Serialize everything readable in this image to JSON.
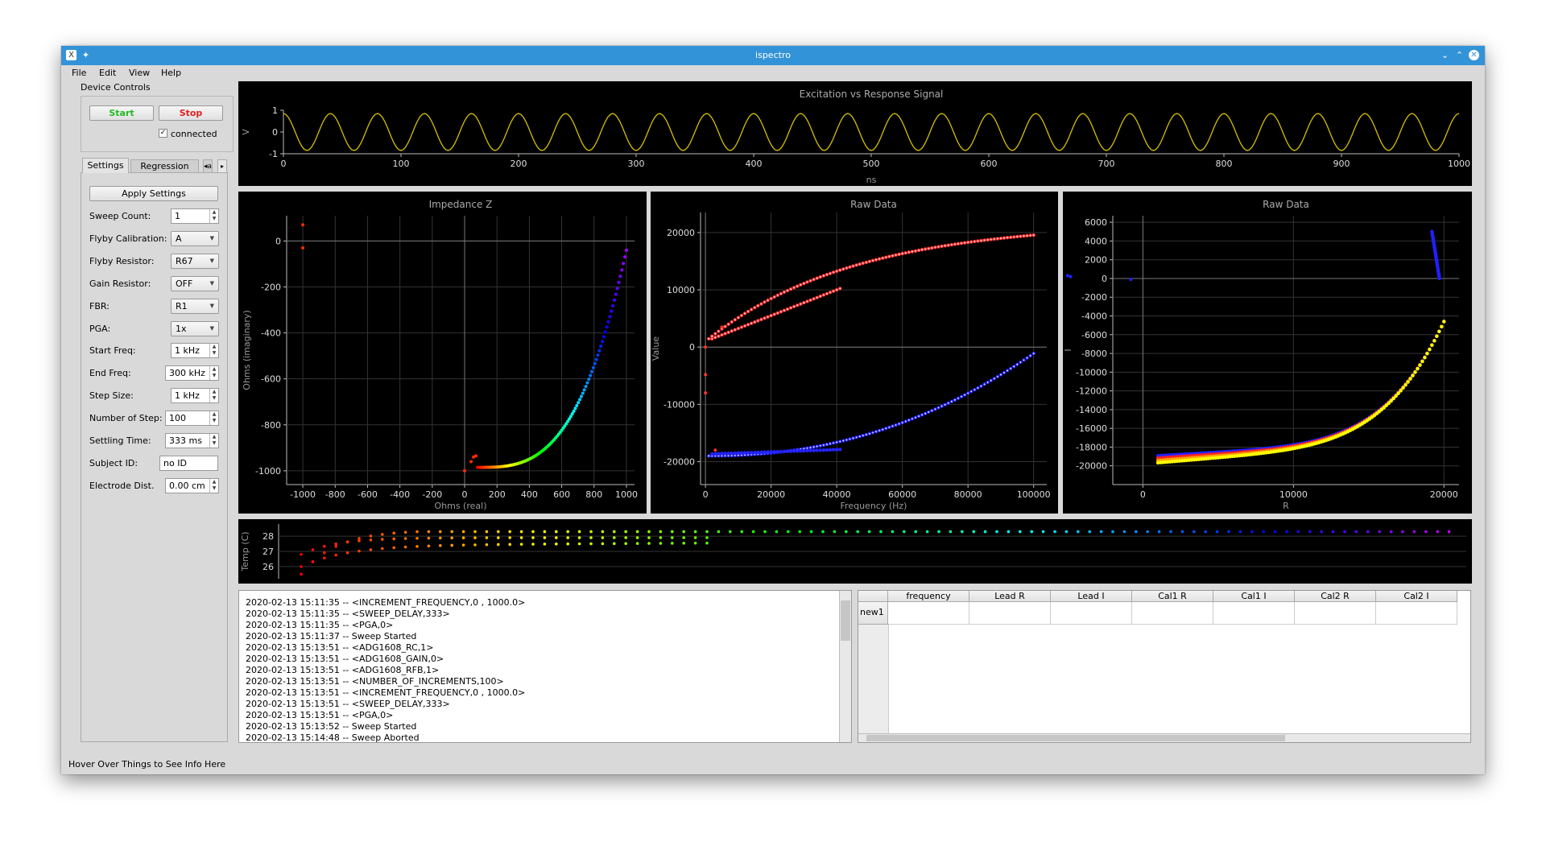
{
  "window": {
    "title": "ispectro"
  },
  "menu": [
    "File",
    "Edit",
    "View",
    "Help"
  ],
  "device_controls": {
    "title": "Device Controls",
    "start": "Start",
    "stop": "Stop",
    "connected_label": "connected",
    "connected_checked": true,
    "start_color": "#22bb22",
    "stop_color": "#dd2222"
  },
  "tabs": [
    "Settings",
    "Regression",
    "a"
  ],
  "settings": {
    "apply": "Apply Settings",
    "rows": [
      {
        "label": "Sweep Count:",
        "value": "1",
        "kind": "spin"
      },
      {
        "label": "Flyby Calibration:",
        "value": "A",
        "kind": "combo"
      },
      {
        "label": "Flyby Resistor:",
        "value": "R67",
        "kind": "combo"
      },
      {
        "label": "Gain Resistor:",
        "value": "OFF",
        "kind": "combo"
      },
      {
        "label": "FBR:",
        "value": "R1",
        "kind": "combo"
      },
      {
        "label": "PGA:",
        "value": "1x",
        "kind": "combo"
      },
      {
        "label": "Start Freq:",
        "value": "1 kHz",
        "kind": "spin"
      },
      {
        "label": "End Freq:",
        "value": "300 kHz",
        "kind": "spin"
      },
      {
        "label": "Step Size:",
        "value": "1 kHz",
        "kind": "spin"
      },
      {
        "label": "Number of Step:",
        "value": "100",
        "kind": "spin"
      },
      {
        "label": "Settling Time:",
        "value": "333 ms",
        "kind": "spin"
      },
      {
        "label": "Subject ID:",
        "value": "no ID",
        "kind": "field"
      },
      {
        "label": "Electrode Dist.",
        "value": "0.00 cm",
        "kind": "spin"
      }
    ]
  },
  "status_bar": "Hover Over Things to See Info Here",
  "log_lines": [
    "2020-02-13 15:11:35 -- <INCREMENT_FREQUENCY,0 , 1000.0>",
    "2020-02-13 15:11:35 -- <SWEEP_DELAY,333>",
    "2020-02-13 15:11:35 -- <PGA,0>",
    "2020-02-13 15:11:37 -- Sweep Started",
    "2020-02-13 15:13:51 -- <ADG1608_RC,1>",
    "2020-02-13 15:13:51 -- <ADG1608_GAIN,0>",
    "2020-02-13 15:13:51 -- <ADG1608_RFB,1>",
    "2020-02-13 15:13:51 -- <NUMBER_OF_INCREMENTS,100>",
    "2020-02-13 15:13:51 -- <INCREMENT_FREQUENCY,0 , 1000.0>",
    "2020-02-13 15:13:51 -- <SWEEP_DELAY,333>",
    "2020-02-13 15:13:51 -- <PGA,0>",
    "2020-02-13 15:13:52 -- Sweep Started",
    "2020-02-13 15:14:48 -- Sweep Aborted"
  ],
  "table": {
    "columns": [
      "frequency",
      "Lead R",
      "Lead I",
      "Cal1 R",
      "Cal1 I",
      "Cal2 R",
      "Cal2 I"
    ],
    "row_header": "new1"
  },
  "chart_data": [
    {
      "type": "line",
      "title": "Excitation vs Response Signal",
      "xlabel": "ns",
      "ylabel": "V",
      "xlim": [
        0,
        1000
      ],
      "ylim": [
        -1,
        1
      ],
      "xticks": [
        0,
        100,
        200,
        300,
        400,
        500,
        600,
        700,
        800,
        900,
        1000
      ],
      "yticks": [
        1,
        0,
        -1
      ],
      "series": [
        {
          "color": "#d4c000",
          "cycles": 25,
          "amplitude": 1
        }
      ]
    },
    {
      "type": "scatter",
      "title": "Impedance Z",
      "xlabel": "Ohms (real)",
      "ylabel": "Ohms (imaginary)",
      "xlim": [
        -1100,
        1050
      ],
      "ylim": [
        -1060,
        110
      ],
      "xticks": [
        -1000,
        -800,
        -600,
        -400,
        -200,
        0,
        200,
        400,
        600,
        800,
        1000
      ],
      "yticks": [
        0,
        -200,
        -400,
        -600,
        -800,
        -1000
      ],
      "points_desc": "curve from (80,-985) to (1000,-40) colored by index red to magenta",
      "outliers": [
        [
          -1000,
          70
        ],
        [
          -1000,
          -30
        ],
        [
          0,
          -1000
        ],
        [
          40,
          -960
        ],
        [
          55,
          -940
        ],
        [
          70,
          -935
        ]
      ]
    },
    {
      "type": "scatter",
      "title": "Raw Data",
      "xlabel": "Frequency (Hz)",
      "ylabel": "Value",
      "xlim": [
        -1500,
        104000
      ],
      "ylim": [
        -24000,
        23500
      ],
      "xticks": [
        0,
        20000,
        40000,
        60000,
        80000,
        100000
      ],
      "yticks": [
        20000,
        10000,
        0,
        -10000,
        -20000
      ],
      "series": [
        {
          "name": "",
          "color": "#ff4040"
        },
        {
          "name": "",
          "color": "#3030ff"
        }
      ]
    },
    {
      "type": "scatter",
      "title": "Raw Data",
      "xlabel": "R",
      "ylabel": "I",
      "xlim": [
        -2000,
        21000
      ],
      "ylim": [
        -22000,
        6700
      ],
      "xticks": [
        0,
        10000,
        20000
      ],
      "yticks": [
        6000,
        4000,
        2000,
        0,
        -2000,
        -4000,
        -6000,
        -8000,
        -10000,
        -12000,
        -14000,
        -16000,
        -18000,
        -20000
      ],
      "series": [
        {
          "color": "#2020ff"
        },
        {
          "color": "#ff2020"
        },
        {
          "color": "#ffa000"
        },
        {
          "color": "#ffff00"
        }
      ]
    },
    {
      "type": "scatter",
      "title": "",
      "xlabel": "",
      "ylabel": "Temp (C)",
      "ylim": [
        25.2,
        28.8
      ],
      "yticks": [
        28,
        27,
        26
      ],
      "points": 100,
      "value_range": [
        25.5,
        28.4
      ]
    }
  ]
}
